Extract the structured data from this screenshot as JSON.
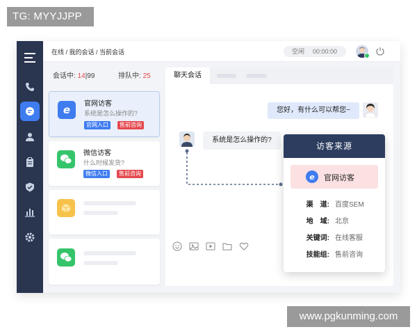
{
  "watermarks": {
    "top": "TG: MYYJJPP",
    "bottom": "www.pgkunming.com"
  },
  "breadcrumb": "在线 / 我的会话 / 当前会话",
  "status": {
    "label": "空闲",
    "timer": "00:00:00"
  },
  "colors": {
    "accent": "#3f7cf0",
    "sidebar": "#2a3550",
    "danger": "#e5484d",
    "wechat": "#35c46b",
    "popup_header": "#2d3d60"
  },
  "sidebar": {
    "items": [
      {
        "icon": "menu-icon"
      },
      {
        "icon": "phone-icon"
      },
      {
        "icon": "chat-bubble-icon",
        "active": true
      },
      {
        "icon": "user-icon"
      },
      {
        "icon": "clipboard-icon"
      },
      {
        "icon": "shield-icon"
      },
      {
        "icon": "bar-chart-icon"
      },
      {
        "icon": "gear-icon"
      }
    ]
  },
  "counts": {
    "in_session_label": "会话中:",
    "in_session": "14",
    "sep": "|",
    "in_session_max": "99",
    "queue_label": "排队中:",
    "queue": "25"
  },
  "sessions": [
    {
      "title": "官网访客",
      "message": "系统是怎么操作的?",
      "tags": [
        "官网入口",
        "售前咨询"
      ],
      "icon": "ie-logo-icon"
    },
    {
      "title": "微信访客",
      "message": "什么时候发货?",
      "tags": [
        "微信入口",
        "售前咨询"
      ],
      "icon": "wechat-logo-icon"
    }
  ],
  "chat": {
    "tab": "聊天会话",
    "agent_message": "您好，有什么可以帮您~",
    "visitor_message": "系统是怎么操作的?"
  },
  "popup": {
    "title": "访客来源",
    "source": "官网访客",
    "rows": [
      {
        "key": "渠　道:",
        "value": "百度SEM"
      },
      {
        "key": "地　域:",
        "value": "北京"
      },
      {
        "key": "关键词:",
        "value": "在线客服"
      },
      {
        "key": "技能组:",
        "value": "售前咨询"
      }
    ]
  }
}
